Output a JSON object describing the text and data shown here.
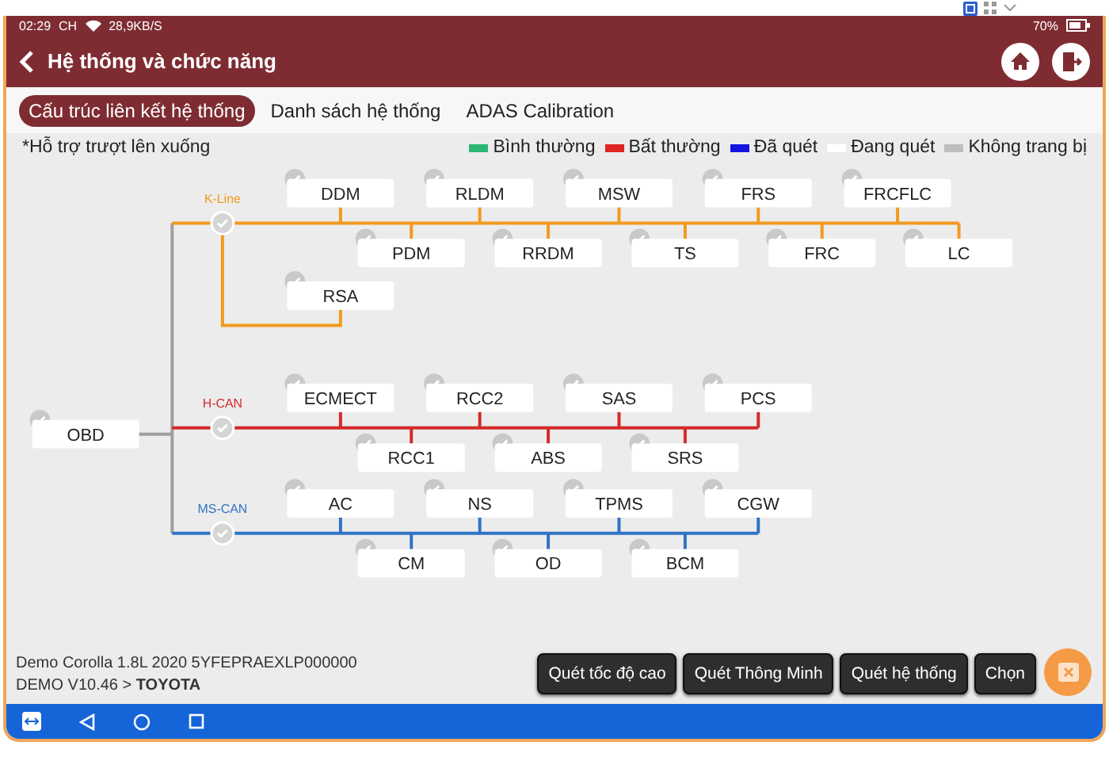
{
  "status_bar": {
    "time": "02:29",
    "period": "CH",
    "speed": "28,9KB/S",
    "battery": "70%"
  },
  "header": {
    "title": "Hệ thống và chức năng"
  },
  "tabs": [
    {
      "label": "Cấu trúc liên kết hệ thống",
      "selected": true
    },
    {
      "label": "Danh sách hệ thống",
      "selected": false
    },
    {
      "label": "ADAS Calibration",
      "selected": false
    }
  ],
  "hint": "*Hỗ trợ trượt lên xuống",
  "legend": [
    {
      "label": "Bình thường",
      "color": "#2bb673"
    },
    {
      "label": "Bất thường",
      "color": "#e02424"
    },
    {
      "label": "Đã quét",
      "color": "#1414e0"
    },
    {
      "label": "Đang quét",
      "color": "#ffffff"
    },
    {
      "label": "Không trang bị",
      "color": "#bdbdbd"
    }
  ],
  "diagram": {
    "root": "OBD",
    "buses": [
      {
        "name": "K-Line",
        "color": "#f39a1e",
        "top": [
          "DDM",
          "RLDM",
          "MSW",
          "FRS",
          "FRCFLC"
        ],
        "bottom": [
          "PDM",
          "RRDM",
          "TS",
          "FRC",
          "LC"
        ],
        "branch": [
          "RSA"
        ]
      },
      {
        "name": "H-CAN",
        "color": "#d42a2a",
        "top": [
          "ECMECT",
          "RCC2",
          "SAS",
          "PCS"
        ],
        "bottom": [
          "RCC1",
          "ABS",
          "SRS"
        ]
      },
      {
        "name": "MS-CAN",
        "color": "#2f73c4",
        "top": [
          "AC",
          "NS",
          "TPMS",
          "CGW"
        ],
        "bottom": [
          "CM",
          "OD",
          "BCM"
        ]
      }
    ]
  },
  "vehicle": {
    "line1": "Demo  Corolla 1.8L 2020  5YFEPRAEXLP000000",
    "line2": "DEMO V10.46 > **TOYOTA**"
  },
  "buttons": [
    "Quét tốc độ cao",
    "Quét Thông Minh",
    "Quét hệ thống",
    "Chọn"
  ]
}
